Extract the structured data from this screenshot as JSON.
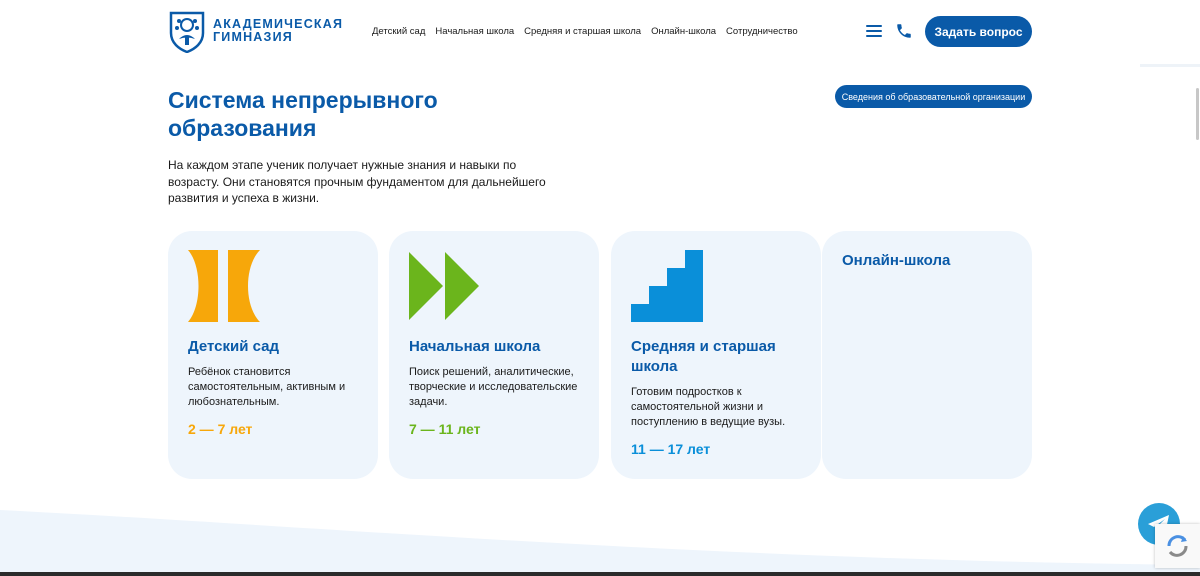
{
  "header": {
    "logo_line1": "Академическая",
    "logo_line2": "гимназия",
    "nav": [
      "Детский сад",
      "Начальная школа",
      "Средняя и старшая школа",
      "Онлайн-школа",
      "Сотрудничество"
    ],
    "ask_button": "Задать вопрос"
  },
  "main": {
    "title_line1": "Система непрерывного",
    "title_line2": "образования",
    "info_button": "Сведения об образовательной организации",
    "intro": "На каждом этапе ученик получает нужные знания и навыки по возрасту. Они становятся прочным фундаментом для дальнейшего развития и успеха в жизни."
  },
  "cards": [
    {
      "name": "Детский сад",
      "desc": "Ребёнок становится самостоятельным, активным и любознательным.",
      "age": "2 — 7 лет",
      "color": "#f7a70a",
      "icon": "kindergarten-shape-icon"
    },
    {
      "name": "Начальная школа",
      "desc": "Поиск решений, аналитические, творческие и исследовательские задачи.",
      "age": "7 — 11 лет",
      "color": "#6bb51c",
      "icon": "double-arrow-icon"
    },
    {
      "name": "Средняя и старшая школа",
      "desc": "Готовим подростков к самостоятельной жизни и поступлению в ведущие вузы.",
      "age": "11 — 17 лет",
      "color": "#0a8fd9",
      "icon": "stairs-icon"
    },
    {
      "name": "Онлайн-школа"
    }
  ],
  "colors": {
    "brand": "#0a5aa8",
    "card_bg": "#eef5fc",
    "telegram": "#2a9fd8"
  }
}
